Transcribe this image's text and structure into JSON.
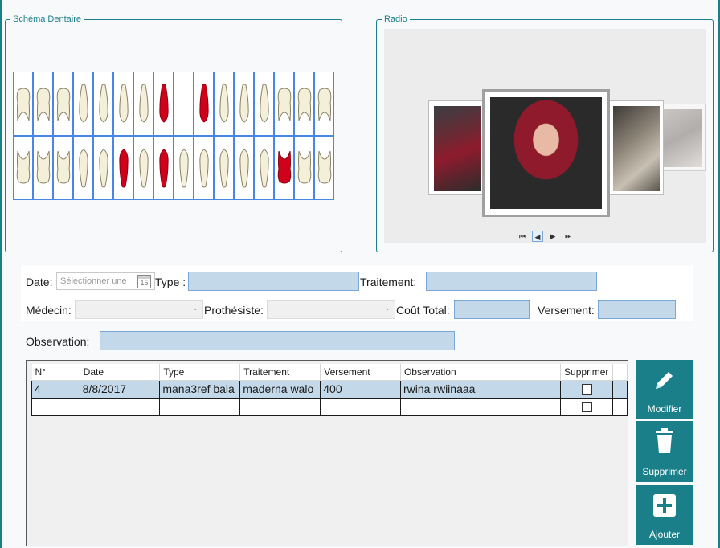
{
  "schema": {
    "legend": "Schéma Dentaire"
  },
  "radio": {
    "legend": "Radio",
    "nav": {
      "first": "⏮",
      "prev": "◀",
      "next": "▶",
      "last": "⏭"
    }
  },
  "form": {
    "date_label": "Date:",
    "date_placeholder": "Sélectionner une",
    "calendar_day": "15",
    "type_label": "Type :",
    "type_value": "",
    "traitement_label": "Traitement:",
    "traitement_value": "",
    "medecin_label": "Médecin:",
    "medecin_value": "",
    "prothesiste_label": "Prothésiste:",
    "prothesiste_value": "",
    "cout_label": "Coût Total:",
    "cout_value": "",
    "versement_label": "Versement:",
    "versement_value": "",
    "observation_label": "Observation:",
    "observation_value": ""
  },
  "grid": {
    "columns": [
      "N°",
      "Date",
      "Type",
      "Traitement",
      "Versement",
      "Observation",
      "Supprimer"
    ],
    "rows": [
      {
        "n": "4",
        "date": "8/8/2017",
        "type": "mana3ref bala",
        "traitement": "maderna walo",
        "versement": "400",
        "observation": "rwina rwiinaaa",
        "supprimer": false
      },
      {
        "n": "",
        "date": "",
        "type": "",
        "traitement": "",
        "versement": "",
        "observation": "",
        "supprimer": false
      }
    ]
  },
  "actions": {
    "modifier": "Modifier",
    "supprimer": "Supprimer",
    "ajouter": "Ajouter"
  },
  "colors": {
    "accent": "#1b7f8a",
    "selected_row": "#c3d8e8",
    "textbox_fill": "#c3d8e8",
    "tooth_highlight": "#d0021b"
  }
}
